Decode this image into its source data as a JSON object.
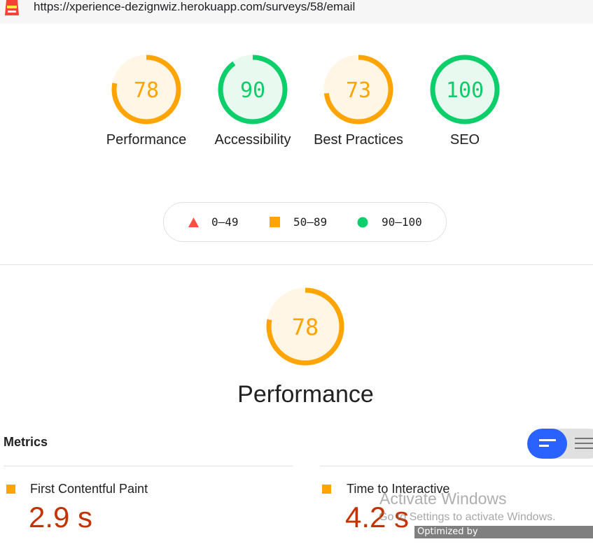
{
  "browser": {
    "url": "https://xperience-dezignwiz.herokuapp.com/surveys/58/email"
  },
  "colors": {
    "pass": "#0cce6b",
    "average": "#ffa400",
    "fail": "#ff4e42",
    "pass_bg": "#e8faf0",
    "average_bg": "#fff6e6"
  },
  "summary_gauges": [
    {
      "label": "Performance",
      "score": "78",
      "rating": "average"
    },
    {
      "label": "Accessibility",
      "score": "90",
      "rating": "pass"
    },
    {
      "label": "Best Practices",
      "score": "73",
      "rating": "average"
    },
    {
      "label": "SEO",
      "score": "100",
      "rating": "pass"
    }
  ],
  "legend": [
    {
      "range": "0–49",
      "shape": "triangle-icon"
    },
    {
      "range": "50–89",
      "shape": "square-icon"
    },
    {
      "range": "90–100",
      "shape": "circle-icon"
    }
  ],
  "performance": {
    "score": "78",
    "title": "Performance"
  },
  "metrics": {
    "title": "Metrics",
    "items": [
      {
        "name": "First Contentful Paint",
        "value": "2.9 s"
      },
      {
        "name": "Time to Interactive",
        "value": "4.2 s"
      }
    ]
  },
  "overlay": {
    "activate_title": "Activate Windows",
    "activate_sub": "Go to Settings to activate Windows.",
    "optimized": "Optimized by www.ImageOptimizer.net"
  }
}
